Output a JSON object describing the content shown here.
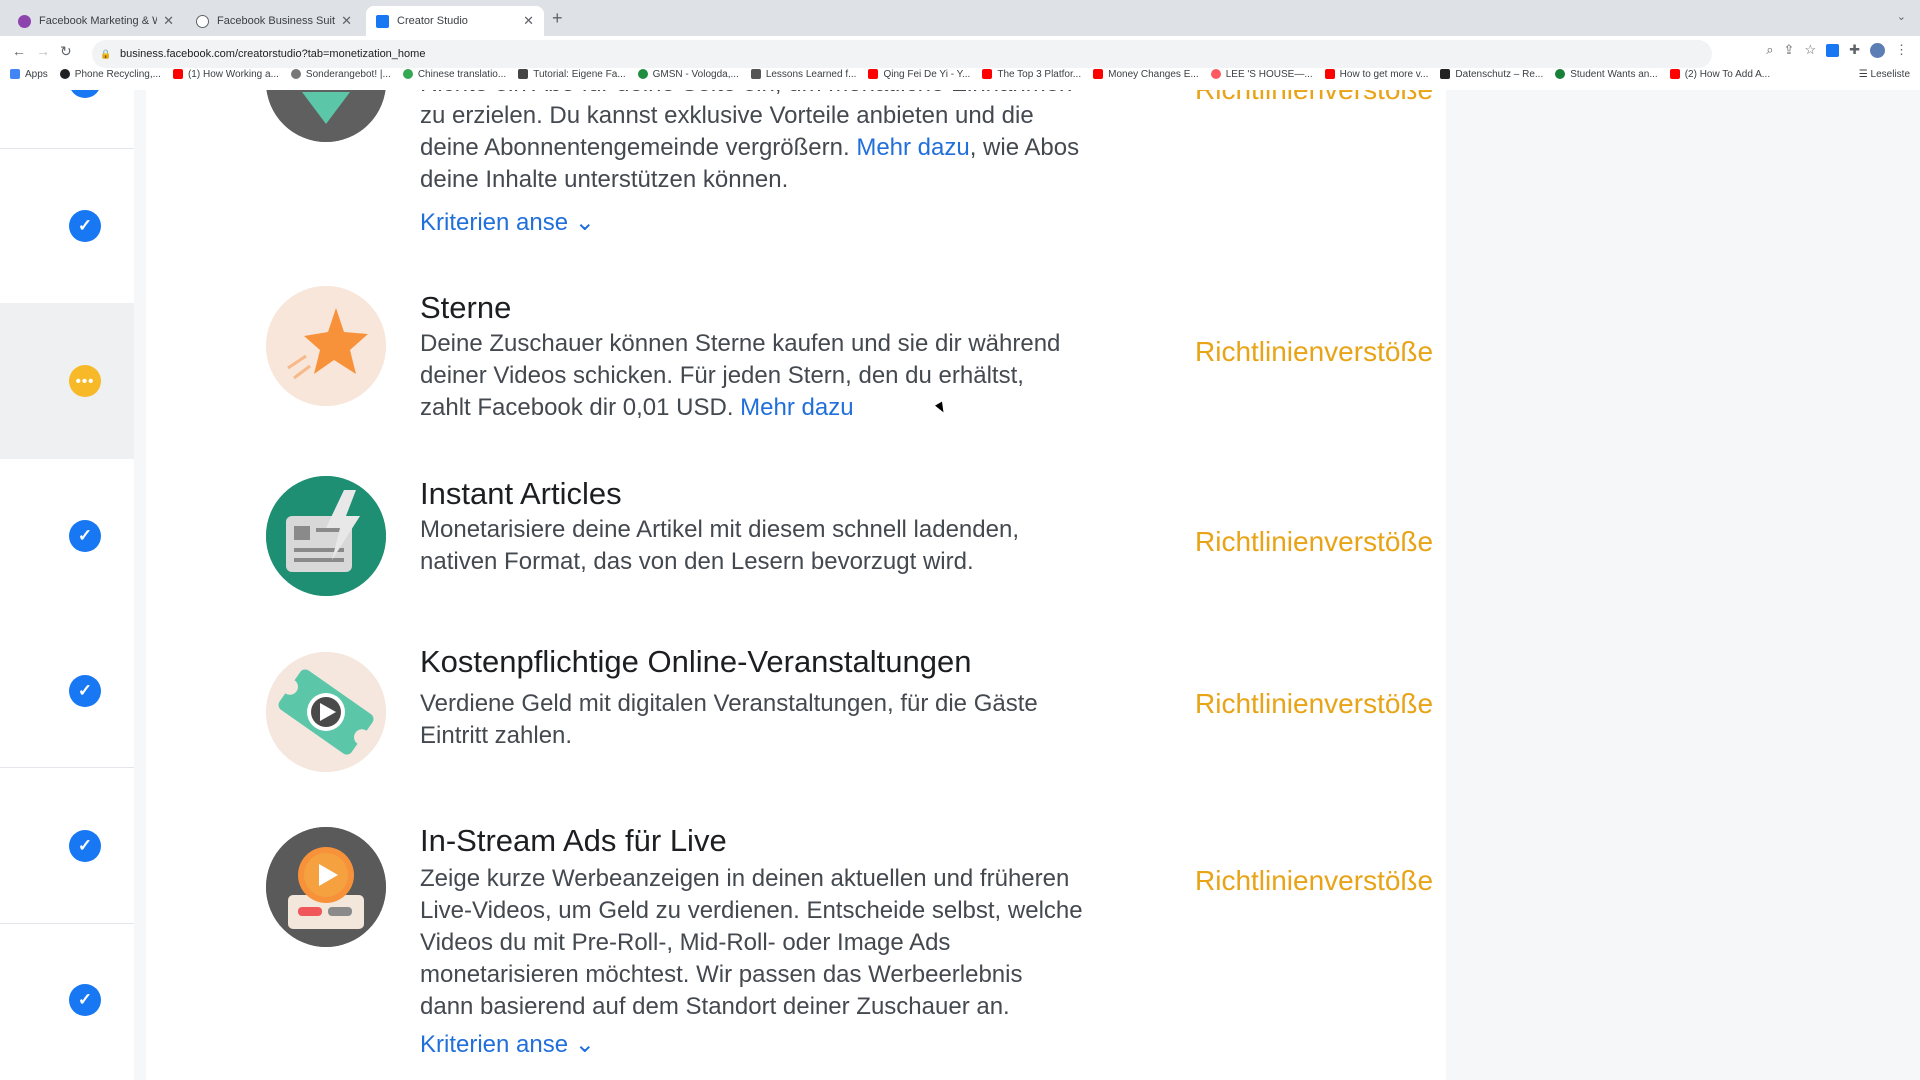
{
  "browser": {
    "tabs": [
      {
        "title": "Facebook Marketing & Werbe...",
        "favicon_color": "#8e44ad"
      },
      {
        "title": "Facebook Business Suite",
        "favicon_color": "#5f6368"
      },
      {
        "title": "Creator Studio",
        "favicon_color": "#1877f2"
      }
    ],
    "url": "business.facebook.com/creatorstudio?tab=monetization_home",
    "bookmarks": [
      {
        "label": "Apps"
      },
      {
        "label": "Phone Recycling,..."
      },
      {
        "label": "(1) How Working a..."
      },
      {
        "label": "Sonderangebot! |..."
      },
      {
        "label": "Chinese translatio..."
      },
      {
        "label": "Tutorial: Eigene Fa..."
      },
      {
        "label": "GMSN - Vologda,..."
      },
      {
        "label": "Lessons Learned f..."
      },
      {
        "label": "Qing Fei De Yi - Y..."
      },
      {
        "label": "The Top 3 Platfor..."
      },
      {
        "label": "Money Changes E..."
      },
      {
        "label": "LEE 'S HOUSE—..."
      },
      {
        "label": "How to get more v..."
      },
      {
        "label": "Datenschutz – Re..."
      },
      {
        "label": "Student Wants an..."
      },
      {
        "label": "(2) How To Add A..."
      }
    ],
    "reading_list": "Leseliste"
  },
  "items": [
    {
      "title": "",
      "desc_lines": [
        "Richte ein Abo für deine Seite ein, um monatliche Einnahmen",
        "zu erzielen. Du kannst exklusive Vorteile anbieten und die",
        "deine Abonnentengemeinde vergrößern.",
        "Mehr dazu",
        ", wie Abos",
        "deine Inhalte unterstützen können."
      ],
      "criteria": "Kriterien anse",
      "status": "Richtlinienverstöße"
    },
    {
      "title": "Sterne",
      "desc_line1": "Deine Zuschauer können Sterne kaufen und sie dir während",
      "desc_line2": "deiner Videos schicken. Für jeden Stern, den du erhältst,",
      "desc_line3": "zahlt Facebook dir 0,01 USD.",
      "link": "Mehr dazu",
      "status": "Richtlinienverstöße"
    },
    {
      "title": "Instant Articles",
      "desc_line1": "Monetarisiere deine Artikel mit diesem schnell ladenden,",
      "desc_line2": "nativen Format, das von den Lesern bevorzugt wird.",
      "status": "Richtlinienverstöße"
    },
    {
      "title": "Kostenpflichtige Online-Veranstaltungen",
      "desc_line1": "Verdiene Geld mit digitalen Veranstaltungen, für die Gäste",
      "desc_line2": "Eintritt zahlen.",
      "status": "Richtlinienverstöße"
    },
    {
      "title": "In-Stream Ads für Live",
      "desc_line1": "Zeige kurze Werbeanzeigen in deinen aktuellen und früheren",
      "desc_line2": "Live-Videos, um Geld zu verdienen. Entscheide selbst, welche",
      "desc_line3": "Videos du mit Pre-Roll-, Mid-Roll- oder Image Ads",
      "desc_line4": "monetarisieren möchtest. Wir passen das Werbeerlebnis",
      "desc_line5": "dann basierend auf dem Standort deiner Zuschauer an.",
      "criteria": "Kriterien anse",
      "status": "Richtlinienverstöße"
    }
  ],
  "rail_icons": [
    "check-icon",
    "check-icon",
    "ellipsis-icon",
    "check-icon",
    "check-icon",
    "check-icon",
    "check-icon"
  ],
  "colors": {
    "accent": "#1877f2",
    "link": "#216fdb",
    "warning": "#e8a317",
    "pending": "#f7b928"
  }
}
